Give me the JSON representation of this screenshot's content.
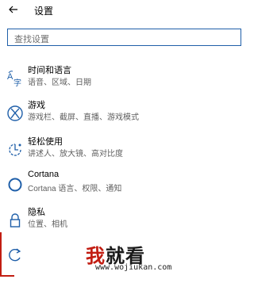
{
  "header": {
    "back_icon": "back-arrow-icon",
    "title": "设置"
  },
  "search": {
    "placeholder": "查找设置"
  },
  "items": [
    {
      "icon": "time-language-icon",
      "name": "时间和语言",
      "desc": "语音、区域、日期"
    },
    {
      "icon": "xbox-gaming-icon",
      "name": "游戏",
      "desc": "游戏栏、截屏、直播、游戏模式"
    },
    {
      "icon": "ease-of-access-icon",
      "name": "轻松使用",
      "desc": "讲述人、放大镜、高对比度"
    },
    {
      "icon": "cortana-circle-icon",
      "name": "Cortana",
      "desc": "Cortana 语言、权限、通知"
    },
    {
      "icon": "privacy-lock-icon",
      "name": "隐私",
      "desc": "位置、相机"
    },
    {
      "icon": "update-sync-icon",
      "name": "",
      "desc": ""
    }
  ],
  "watermark": {
    "logo_part1": "我",
    "logo_part2": "就看",
    "url": "www.wojiukan.com"
  },
  "colors": {
    "accent": "#1f5fa9",
    "watermark_red": "#c21d12",
    "desc_gray": "#5f5f5f"
  }
}
